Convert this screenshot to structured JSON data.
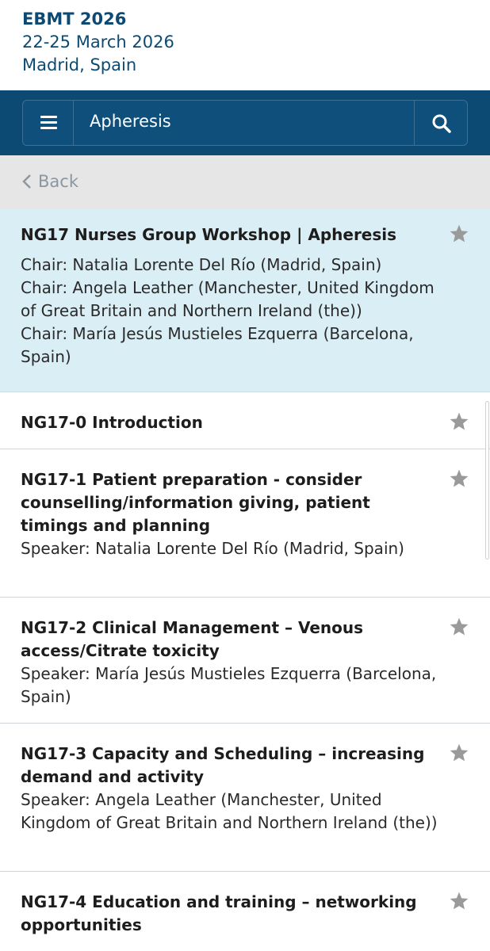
{
  "conference": {
    "title": "EBMT 2026",
    "dates": "22-25 March 2026",
    "location": "Madrid, Spain"
  },
  "search": {
    "query": "Apheresis",
    "menu_icon": "hamburger-icon",
    "search_icon": "search-icon"
  },
  "nav": {
    "back_label": "Back"
  },
  "session": {
    "title": "NG17 Nurses Group Workshop | Apheresis",
    "chairs": [
      "Chair: Natalia Lorente Del Río (Madrid, Spain)",
      "Chair: Angela Leather (Manchester, United Kingdom of Great Britain and Northern Ireland (the))",
      "Chair: María Jesús Mustieles Ezquerra (Barcelona, Spain)"
    ]
  },
  "items": [
    {
      "title": "NG17-0 Introduction",
      "speaker": ""
    },
    {
      "title": "NG17-1 Patient preparation - consider counselling/information giving, patient timings and planning",
      "speaker": "Speaker: Natalia Lorente Del Río (Madrid, Spain)"
    },
    {
      "title": "NG17-2 Clinical Management – Venous access/Citrate toxicity",
      "speaker": "Speaker: María Jesús Mustieles Ezquerra (Barcelona, Spain)"
    },
    {
      "title": "NG17-3 Capacity and Scheduling – increasing demand and activity",
      "speaker": "Speaker: Angela Leather (Manchester, United Kingdom of Great Britain and Northern Ireland (the))"
    },
    {
      "title": "NG17-4 Education and training – networking opportunities",
      "speaker": ""
    }
  ],
  "colors": {
    "brand": "#0d4a73",
    "session_bg": "#daeef5",
    "star": "#9a9a9a"
  }
}
